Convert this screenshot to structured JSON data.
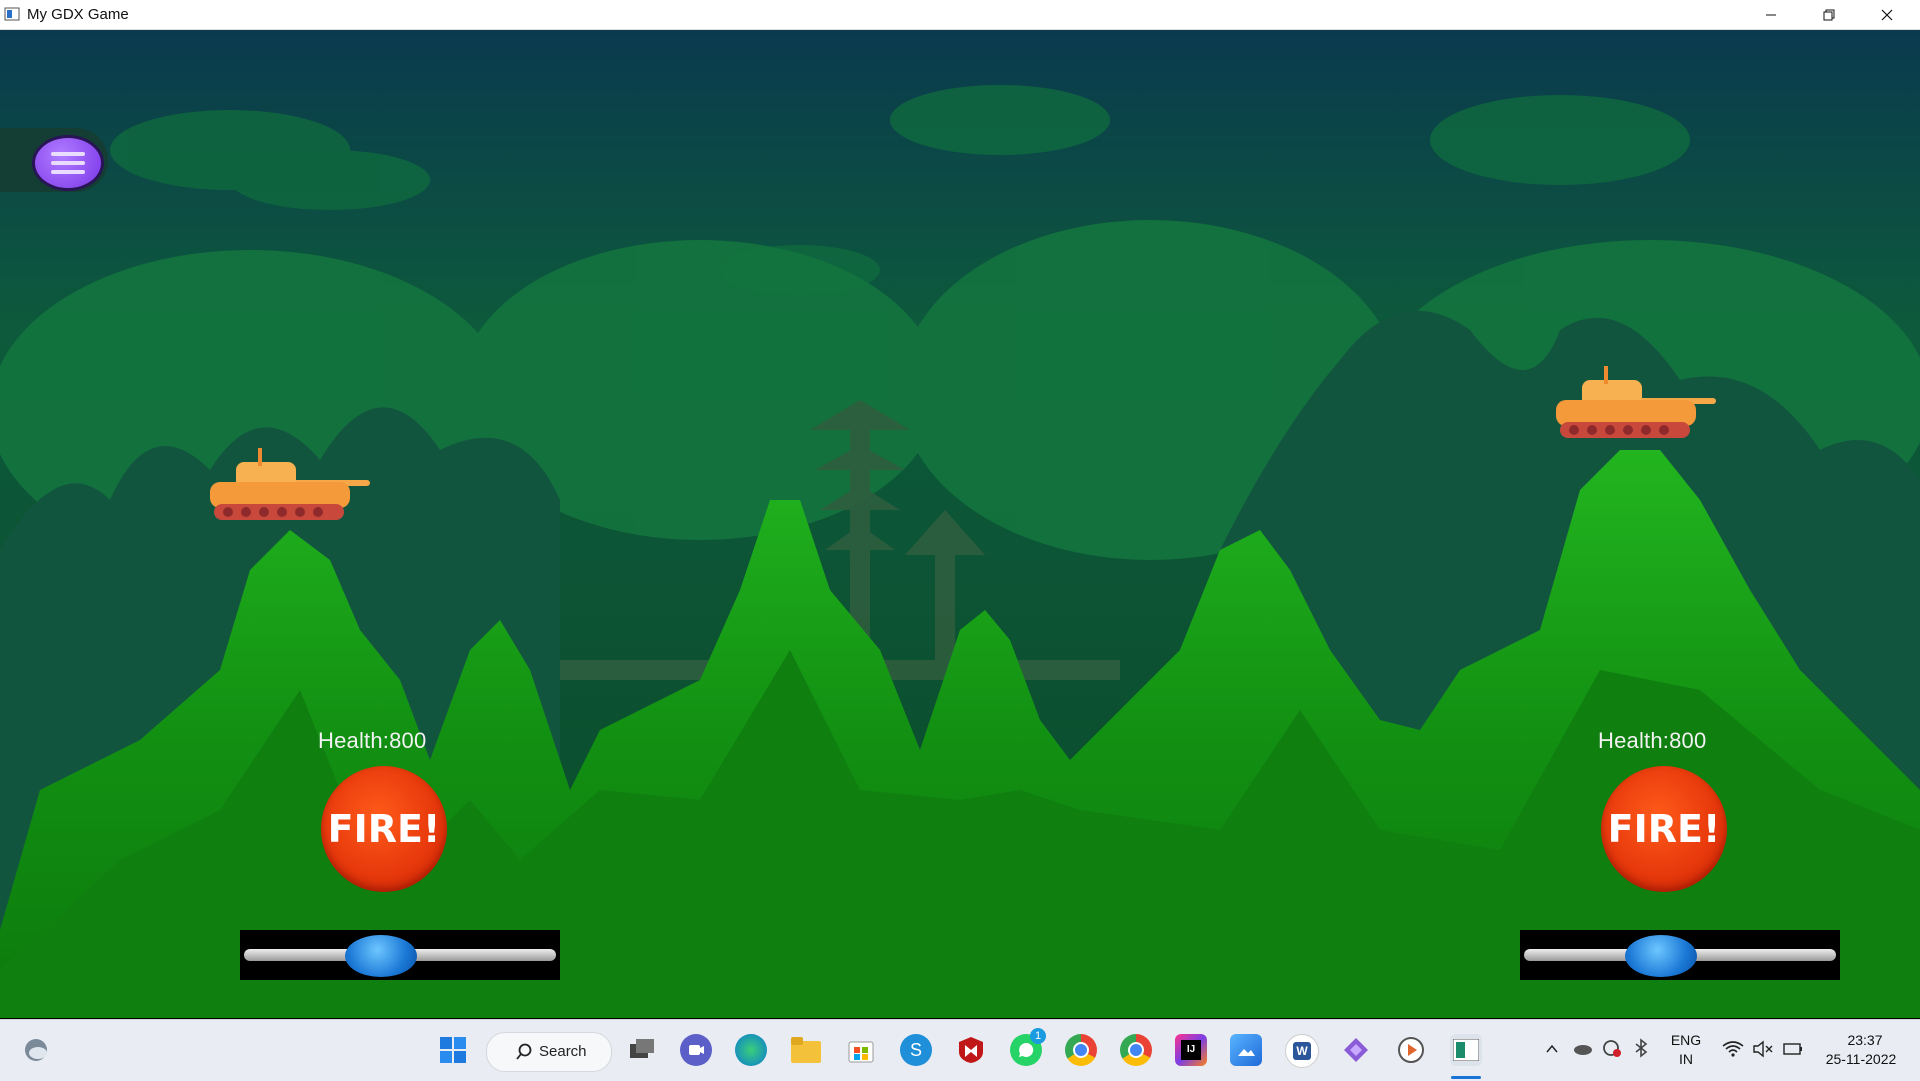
{
  "window": {
    "title": "My GDX Game"
  },
  "players": [
    {
      "health_label": "Health:800",
      "fire_label": "FIRE!",
      "power": 0.42
    },
    {
      "health_label": "Health:800",
      "fire_label": "FIRE!",
      "power": 0.42
    }
  ],
  "taskbar": {
    "search_label": "Search",
    "language": "ENG",
    "region": "IN",
    "time": "23:37",
    "date": "25-11-2022",
    "whatsapp_badge": "1",
    "icons": [
      "weather-icon",
      "start-icon",
      "search-icon",
      "task-view-icon",
      "chat-icon",
      "edge-icon",
      "file-explorer-icon",
      "store-icon",
      "skype-icon",
      "mcafee-icon",
      "whatsapp-icon",
      "chrome-icon",
      "chrome-profile-icon",
      "intellij-icon",
      "photos-icon",
      "word-icon",
      "visual-studio-icon",
      "media-player-icon",
      "game-window-icon"
    ]
  },
  "colors": {
    "sky_top": "#0b3a4a",
    "sky_mid": "#0d5a3a",
    "hill_green": "#17a01a",
    "fire_red": "#e83a0c",
    "menu_purple": "#8a46f0"
  }
}
